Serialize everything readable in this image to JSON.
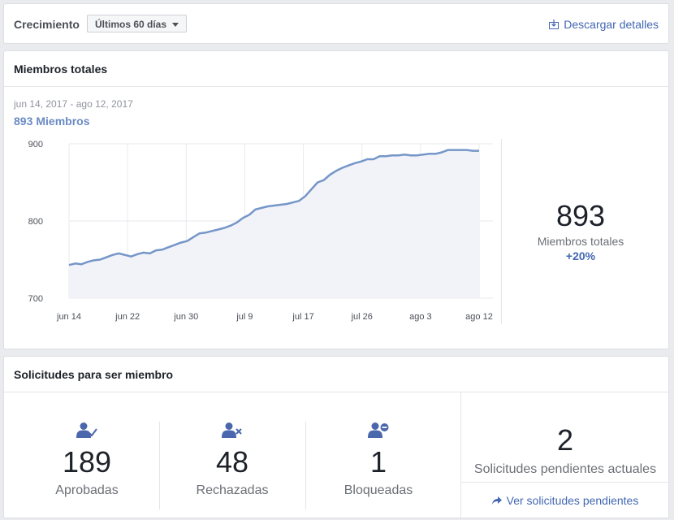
{
  "header": {
    "title": "Crecimiento",
    "period_selected": "Últimos 60 días",
    "download_label": "Descargar detalles"
  },
  "members_card": {
    "title": "Miembros totales",
    "date_range": "jun 14, 2017 - ago 12, 2017",
    "count": "893",
    "count_unit": "Miembros",
    "summary_value": "893",
    "summary_label": "Miembros totales",
    "summary_change": "+20%"
  },
  "chart_data": {
    "type": "area",
    "x_tick_labels": [
      "jun 14",
      "jun 22",
      "jun 30",
      "jul 9",
      "jul 17",
      "jul 26",
      "ago 3",
      "ago 12"
    ],
    "y_ticks": [
      700,
      800,
      900
    ],
    "ylim": [
      700,
      900
    ],
    "grid": true,
    "color": "#7596c8",
    "fill": "#f1f3f8",
    "values": [
      743,
      745,
      744,
      747,
      749,
      750,
      753,
      756,
      758,
      756,
      754,
      757,
      759,
      758,
      762,
      763,
      766,
      769,
      772,
      774,
      779,
      784,
      785,
      787,
      789,
      791,
      794,
      798,
      804,
      808,
      815,
      817,
      819,
      820,
      821,
      822,
      824,
      826,
      832,
      841,
      850,
      853,
      860,
      865,
      869,
      872,
      875,
      877,
      880,
      880,
      884,
      884,
      885,
      885,
      886,
      885,
      885,
      886,
      887,
      887,
      889,
      892,
      892,
      892,
      892,
      891,
      891
    ]
  },
  "requests_card": {
    "title": "Solicitudes para ser miembro",
    "approved": {
      "value": "189",
      "label": "Aprobadas",
      "icon": "user-check-icon"
    },
    "rejected": {
      "value": "48",
      "label": "Rechazadas",
      "icon": "user-x-icon"
    },
    "blocked": {
      "value": "1",
      "label": "Bloqueadas",
      "icon": "user-minus-icon"
    },
    "pending": {
      "value": "2",
      "label": "Solicitudes pendientes actuales",
      "link_label": "Ver solicitudes pendientes"
    }
  }
}
